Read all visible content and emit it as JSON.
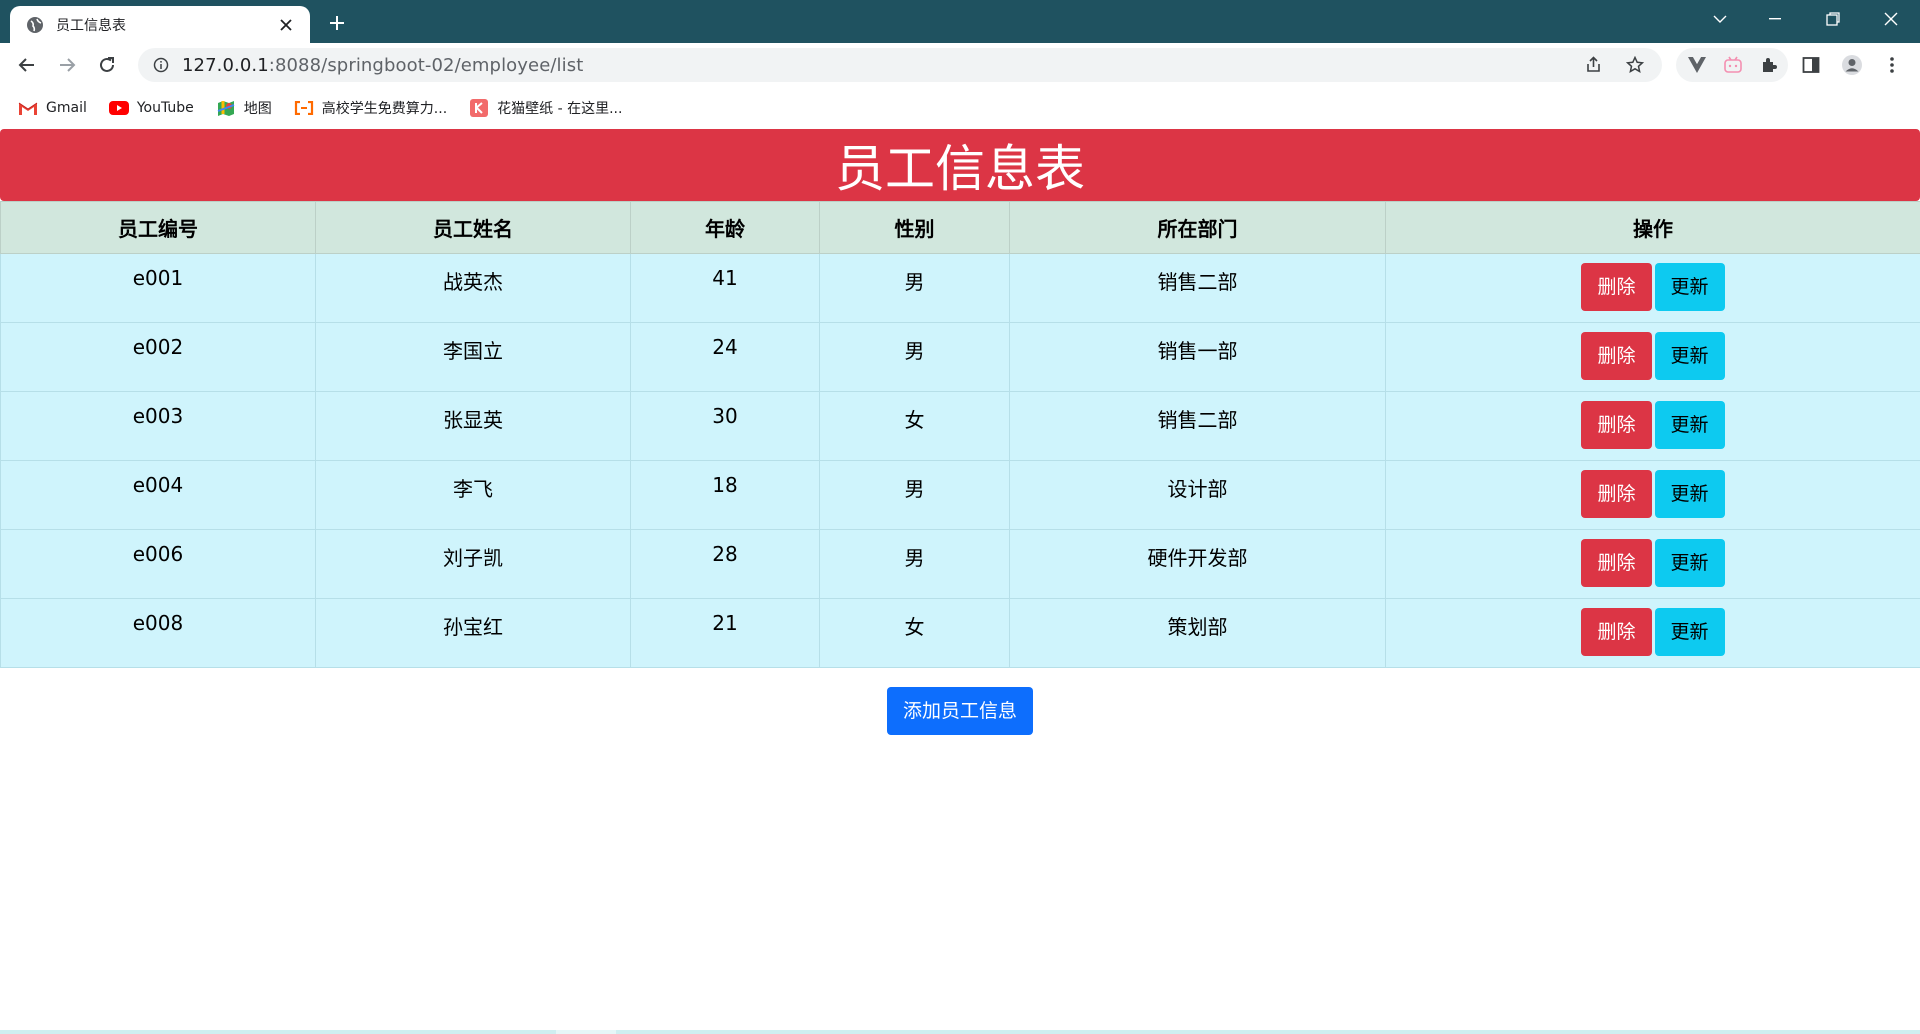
{
  "browser": {
    "tab": {
      "title": "员工信息表"
    },
    "url": {
      "host": "127.0.0.1",
      "rest": ":8088/springboot-02/employee/list"
    },
    "bookmarks": [
      {
        "label": "Gmail",
        "icon": "gmail-icon"
      },
      {
        "label": "YouTube",
        "icon": "youtube-icon"
      },
      {
        "label": "地图",
        "icon": "maps-icon"
      },
      {
        "label": "高校学生免费算力...",
        "icon": "aliyun-icon"
      },
      {
        "label": "花猫壁纸 - 在这里...",
        "icon": "wallpaper-icon"
      }
    ]
  },
  "page": {
    "title": "员工信息表",
    "table": {
      "headers": [
        "员工编号",
        "员工姓名",
        "年龄",
        "性别",
        "所在部门",
        "操作"
      ],
      "rows": [
        {
          "id": "e001",
          "name": "战英杰",
          "age": "41",
          "gender": "男",
          "dept": "销售二部"
        },
        {
          "id": "e002",
          "name": "李国立",
          "age": "24",
          "gender": "男",
          "dept": "销售一部"
        },
        {
          "id": "e003",
          "name": "张显英",
          "age": "30",
          "gender": "女",
          "dept": "销售二部"
        },
        {
          "id": "e004",
          "name": "李飞",
          "age": "18",
          "gender": "男",
          "dept": "设计部"
        },
        {
          "id": "e006",
          "name": "刘子凯",
          "age": "28",
          "gender": "男",
          "dept": "硬件开发部"
        },
        {
          "id": "e008",
          "name": "孙宝红",
          "age": "21",
          "gender": "女",
          "dept": "策划部"
        }
      ],
      "delete_label": "删除",
      "update_label": "更新"
    },
    "add_label": "添加员工信息"
  },
  "colors": {
    "banner": "#dc3545",
    "header_bg": "#d1e7dd",
    "row_bg": "#cff4fc",
    "info_btn": "#0dcaf0",
    "primary_btn": "#0d6efd",
    "titlebar": "#1f5260"
  }
}
